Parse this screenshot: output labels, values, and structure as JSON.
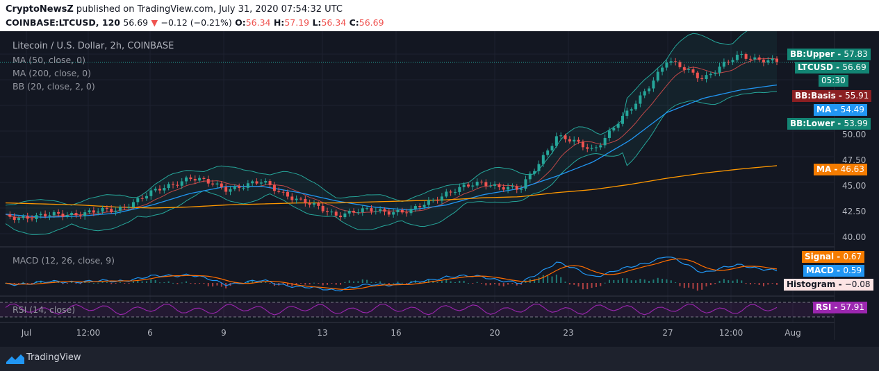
{
  "header": {
    "publisher": "CryptoNewsZ",
    "published_text": "published on TradingView.com, July 31, 2020 07:54:32 UTC",
    "symbol": "COINBASE:LTCUSD, 120",
    "last": "56.69",
    "change_arrow": "▼",
    "change": "−0.12 (−0.21%)",
    "o_label": "O:",
    "o": "56.34",
    "h_label": "H:",
    "h": "57.19",
    "l_label": "L:",
    "l": "56.34",
    "c_label": "C:",
    "c": "56.69"
  },
  "chart_info": {
    "title": "Litecoin / U.S. Dollar, 2h, COINBASE",
    "ma50": "MA (50, close, 0)",
    "ma200": "MA (200, close, 0)",
    "bb": "BB (20, close, 2, 0)",
    "macd": "MACD (12, 26, close, 9)",
    "rsi": "RSI (14, close)"
  },
  "price_tags": {
    "bb_upper": {
      "label": "BB:Upper",
      "value": "57.83"
    },
    "ltcusd": {
      "label": "LTCUSD",
      "value": "56.69"
    },
    "timer": "05:30",
    "bb_basis": {
      "label": "BB:Basis",
      "value": "55.91"
    },
    "ma": {
      "label": "MA",
      "value": "54.49"
    },
    "bb_lower": {
      "label": "BB:Lower",
      "value": "53.99"
    },
    "ma200": {
      "label": "MA",
      "value": "46.63"
    },
    "signal": {
      "label": "Signal",
      "value": "0.67"
    },
    "macd": {
      "label": "MACD",
      "value": "0.59"
    },
    "histogram": {
      "label": "Histogram",
      "value": "−0.08"
    },
    "rsi": {
      "label": "RSI",
      "value": "57.91"
    }
  },
  "y_axis_labels": [
    "50.00",
    "47.50",
    "45.00",
    "42.50",
    "40.00"
  ],
  "x_axis_labels": [
    "Jul",
    "12:00",
    "6",
    "9",
    "13",
    "16",
    "20",
    "23",
    "27",
    "12:00",
    "Aug"
  ],
  "footer": {
    "brand": "TradingView"
  },
  "colors": {
    "background": "#131722",
    "up": "#26a69a",
    "down": "#ef5350",
    "ma50": "#2196f3",
    "ma200": "#ff9800",
    "bb_band": "#26a69a",
    "bb_basis": "#ef5350",
    "rsi": "#9c27b0",
    "macd": "#2196f3",
    "signal": "#ff6d00"
  },
  "chart_data": {
    "type": "line",
    "title": "Litecoin / U.S. Dollar, 2h, COINBASE",
    "x": [
      "Jul",
      "12:00",
      "6",
      "9",
      "13",
      "16",
      "20",
      "23",
      "27",
      "12:00",
      "Aug"
    ],
    "ylim": [
      39.5,
      58.5
    ],
    "y_ticks": [
      40,
      42.5,
      45,
      47.5,
      50
    ],
    "series": [
      {
        "name": "LTCUSD",
        "values": [
          41.6,
          41.7,
          42.0,
          42.3,
          44.0,
          45.5,
          44.4,
          45.0,
          43.2,
          41.9,
          42.3,
          42.1,
          44.0,
          45.0,
          44.2,
          49.5,
          48.2,
          52.0,
          56.8,
          55.2,
          57.4,
          56.69
        ]
      },
      {
        "name": "MA (50)",
        "values": [
          41.9,
          41.6,
          41.7,
          42.0,
          42.8,
          43.9,
          44.6,
          44.6,
          44.0,
          43.2,
          42.6,
          42.3,
          42.8,
          43.8,
          44.4,
          45.6,
          47.0,
          49.1,
          51.8,
          53.2,
          54.0,
          54.49
        ]
      },
      {
        "name": "MA (200)",
        "values": [
          43.0,
          42.9,
          42.8,
          42.6,
          42.5,
          42.6,
          42.8,
          42.9,
          43.0,
          43.0,
          43.1,
          43.2,
          43.3,
          43.5,
          43.6,
          44.0,
          44.3,
          44.8,
          45.4,
          45.9,
          46.3,
          46.63
        ]
      }
    ],
    "indicators": {
      "bb_upper": 57.83,
      "bb_basis": 55.91,
      "bb_lower": 53.99,
      "macd": 0.59,
      "signal": 0.67,
      "histogram": -0.08,
      "rsi": 57.91
    }
  }
}
